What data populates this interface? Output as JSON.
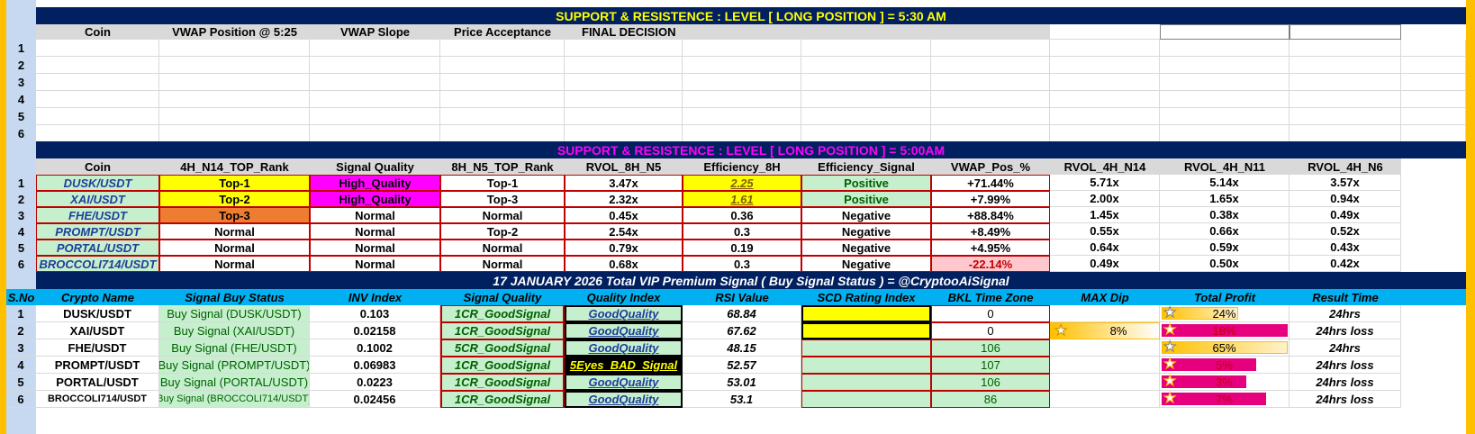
{
  "top": {
    "banner": "SUPPORT  &  RESISTENCE  :  LEVEL    [   LONG  POSITION  ]       =       5:30 AM",
    "headers": [
      "Coin",
      "VWAP Position @ 5:25",
      "VWAP Slope",
      "Price Acceptance",
      "FINAL DECISION"
    ],
    "row_numbers": [
      "1",
      "2",
      "3",
      "4",
      "5",
      "6"
    ]
  },
  "middle": {
    "banner": "SUPPORT  &  RESISTENCE  :  LEVEL    [   LONG   POSITION  ]       =       5:00AM",
    "headers": [
      "Coin",
      "4H_N14_TOP_Rank",
      "Signal Quality",
      "8H_N5_TOP_Rank",
      "RVOL_8H_N5",
      "Efficiency_8H",
      "Efficiency_Signal",
      "VWAP_Pos_%",
      "RVOL_4H_N14",
      "RVOL_4H_N11",
      "RVOL_4H_N6"
    ],
    "rows": [
      {
        "n": "1",
        "coin": "DUSK/USDT",
        "rank4h": "Top-1",
        "quality": "High_Quality",
        "rank8h": "Top-1",
        "rvol8h": "3.47x",
        "eff": "2.25",
        "effsig": "Positive",
        "vwap": "+71.44%",
        "r14": "5.71x",
        "r11": "5.14x",
        "r6": "3.57x"
      },
      {
        "n": "2",
        "coin": "XAI/USDT",
        "rank4h": "Top-2",
        "quality": "High_Quality",
        "rank8h": "Top-3",
        "rvol8h": "2.32x",
        "eff": "1.61",
        "effsig": "Positive",
        "vwap": "+7.99%",
        "r14": "2.00x",
        "r11": "1.65x",
        "r6": "0.94x"
      },
      {
        "n": "3",
        "coin": "FHE/USDT",
        "rank4h": "Top-3",
        "quality": "Normal",
        "rank8h": "Normal",
        "rvol8h": "0.45x",
        "eff": "0.36",
        "effsig": "Negative",
        "vwap": "+88.84%",
        "r14": "1.45x",
        "r11": "0.38x",
        "r6": "0.49x"
      },
      {
        "n": "4",
        "coin": "PROMPT/USDT",
        "rank4h": "Normal",
        "quality": "Normal",
        "rank8h": "Top-2",
        "rvol8h": "2.54x",
        "eff": "0.3",
        "effsig": "Negative",
        "vwap": "+8.49%",
        "r14": "0.55x",
        "r11": "0.66x",
        "r6": "0.52x"
      },
      {
        "n": "5",
        "coin": "PORTAL/USDT",
        "rank4h": "Normal",
        "quality": "Normal",
        "rank8h": "Normal",
        "rvol8h": "0.79x",
        "eff": "0.19",
        "effsig": "Negative",
        "vwap": "+4.95%",
        "r14": "0.64x",
        "r11": "0.59x",
        "r6": "0.43x"
      },
      {
        "n": "6",
        "coin": "BROCCOLI714/USDT",
        "rank4h": "Normal",
        "quality": "Normal",
        "rank8h": "Normal",
        "rvol8h": "0.68x",
        "eff": "0.3",
        "effsig": "Negative",
        "vwap": "-22.14%",
        "r14": "0.49x",
        "r11": "0.50x",
        "r6": "0.42x"
      }
    ]
  },
  "bottom": {
    "banner": "17  JANUARY   2026   Total VIP Premium Signal  ( Buy Signal Status )    =    @CryptooAiSignal",
    "headers": [
      "S.No",
      "Crypto Name",
      "Signal Buy Status",
      "INV  Index",
      "Signal Quality",
      "Quality Index",
      "RSI Value",
      "SCD  Rating Index",
      "BKL Time Zone",
      "MAX Dip",
      "Total Profit",
      "Result Time"
    ],
    "rows": [
      {
        "n": "1",
        "name": "DUSK/USDT",
        "status": "Buy Signal (DUSK/USDT)",
        "inv": "0.103",
        "sq": "1CR_GoodSignal",
        "qi": "GoodQuality",
        "rsi": "68.84",
        "bkl": "0",
        "dip": "",
        "profit": "24%",
        "profit_fill": 0.24,
        "result": "24hrs"
      },
      {
        "n": "2",
        "name": "XAI/USDT",
        "status": "Buy Signal (XAI/USDT)",
        "inv": "0.02158",
        "sq": "1CR_GoodSignal",
        "qi": "GoodQuality",
        "rsi": "67.62",
        "bkl": "0",
        "dip": "8%",
        "profit": "18%",
        "profit_fill": 0.18,
        "result": "24hrs loss"
      },
      {
        "n": "3",
        "name": "FHE/USDT",
        "status": "Buy Signal (FHE/USDT)",
        "inv": "0.1002",
        "sq": "5CR_GoodSignal",
        "qi": "GoodQuality",
        "rsi": "48.15",
        "bkl": "106",
        "dip": "",
        "profit": "65%",
        "profit_fill": 0.65,
        "result": "24hrs"
      },
      {
        "n": "4",
        "name": "PROMPT/USDT",
        "status": "Buy Signal (PROMPT/USDT)",
        "inv": "0.06983",
        "sq": "1CR_GoodSignal",
        "qi": "5Eyes_BAD_Signal",
        "rsi": "52.57",
        "bkl": "107",
        "dip": "",
        "profit": "5%",
        "profit_fill": 0.05,
        "result": "24hrs loss"
      },
      {
        "n": "5",
        "name": "PORTAL/USDT",
        "status": "Buy Signal (PORTAL/USDT)",
        "inv": "0.0223",
        "sq": "1CR_GoodSignal",
        "qi": "GoodQuality",
        "rsi": "53.01",
        "bkl": "106",
        "dip": "",
        "profit": "3%",
        "profit_fill": 0.03,
        "result": "24hrs loss"
      },
      {
        "n": "6",
        "name": "BROCCOLI714/USDT",
        "status": "Buy Signal (BROCCOLI714/USDT)",
        "inv": "0.02456",
        "sq": "1CR_GoodSignal",
        "qi": "GoodQuality",
        "rsi": "53.1",
        "bkl": "86",
        "dip": "",
        "profit": "7%",
        "profit_fill": 0.07,
        "result": "24hrs loss"
      }
    ]
  },
  "colors": {
    "banner": "#002060",
    "banner_text": "#ffff00",
    "accent_blue": "#00b0f0",
    "gold": "#ffc000",
    "green_fill": "#c6efce",
    "magenta": "#ff00ff",
    "pink_loss": "#e6007e"
  },
  "icons": [
    "star-icon"
  ]
}
